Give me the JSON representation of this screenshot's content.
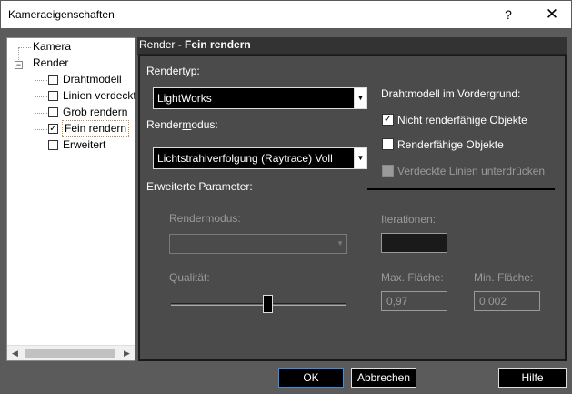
{
  "window": {
    "title": "Kameraeigenschaften",
    "help_glyph": "?",
    "close_glyph": "✕"
  },
  "tree": {
    "expander_glyph": "−",
    "items": [
      {
        "label": "Kamera"
      },
      {
        "label": "Render"
      },
      {
        "label": "Drahtmodell",
        "checked": false
      },
      {
        "label": "Linien verdeckt",
        "checked": false
      },
      {
        "label": "Grob rendern",
        "checked": false
      },
      {
        "label": "Fein rendern",
        "checked": true,
        "selected": true
      },
      {
        "label": "Erweitert",
        "checked": false
      }
    ],
    "scroll_left": "◀",
    "scroll_right": "▶"
  },
  "panel": {
    "header_prefix": "Render - ",
    "header_bold": "Fein rendern",
    "rendertyp_label_pre": "Render",
    "rendertyp_label_u": "t",
    "rendertyp_label_post": "yp:",
    "rendertyp_value": "LightWorks",
    "rendermodus_label_pre": "Render",
    "rendermodus_label_u": "m",
    "rendermodus_label_post": "odus:",
    "rendermodus_value": "Lichtstrahlverfolgung (Raytrace) Voll",
    "combo_arrow": "▼",
    "erweiterte_label": "Erweiterte Parameter:",
    "adv_rendermodus_label": "Rendermodus:",
    "iterationen_label": "Iterationen:",
    "qualitaet_label": "Qualität:",
    "max_flaeche_label": "Max. Fläche:",
    "max_flaeche_value": "0,97",
    "min_flaeche_label": "Min. Fläche:",
    "min_flaeche_value": "0,002",
    "drahtmodell_heading": "Drahtmodell im Vordergrund:",
    "check_mark": "✓",
    "cb_nicht_renderfaehig": {
      "label": "Nicht renderfähige Objekte",
      "checked": true
    },
    "cb_renderfaehig": {
      "label": "Renderfähige Objekte",
      "checked": false
    },
    "cb_verdeckte": {
      "label": "Verdeckte Linien unterdrücken",
      "checked": false,
      "disabled": true
    },
    "quality_level_fraction": 0.55
  },
  "buttons": {
    "ok": "OK",
    "abbrechen": "Abbrechen",
    "hilfe": "Hilfe"
  }
}
